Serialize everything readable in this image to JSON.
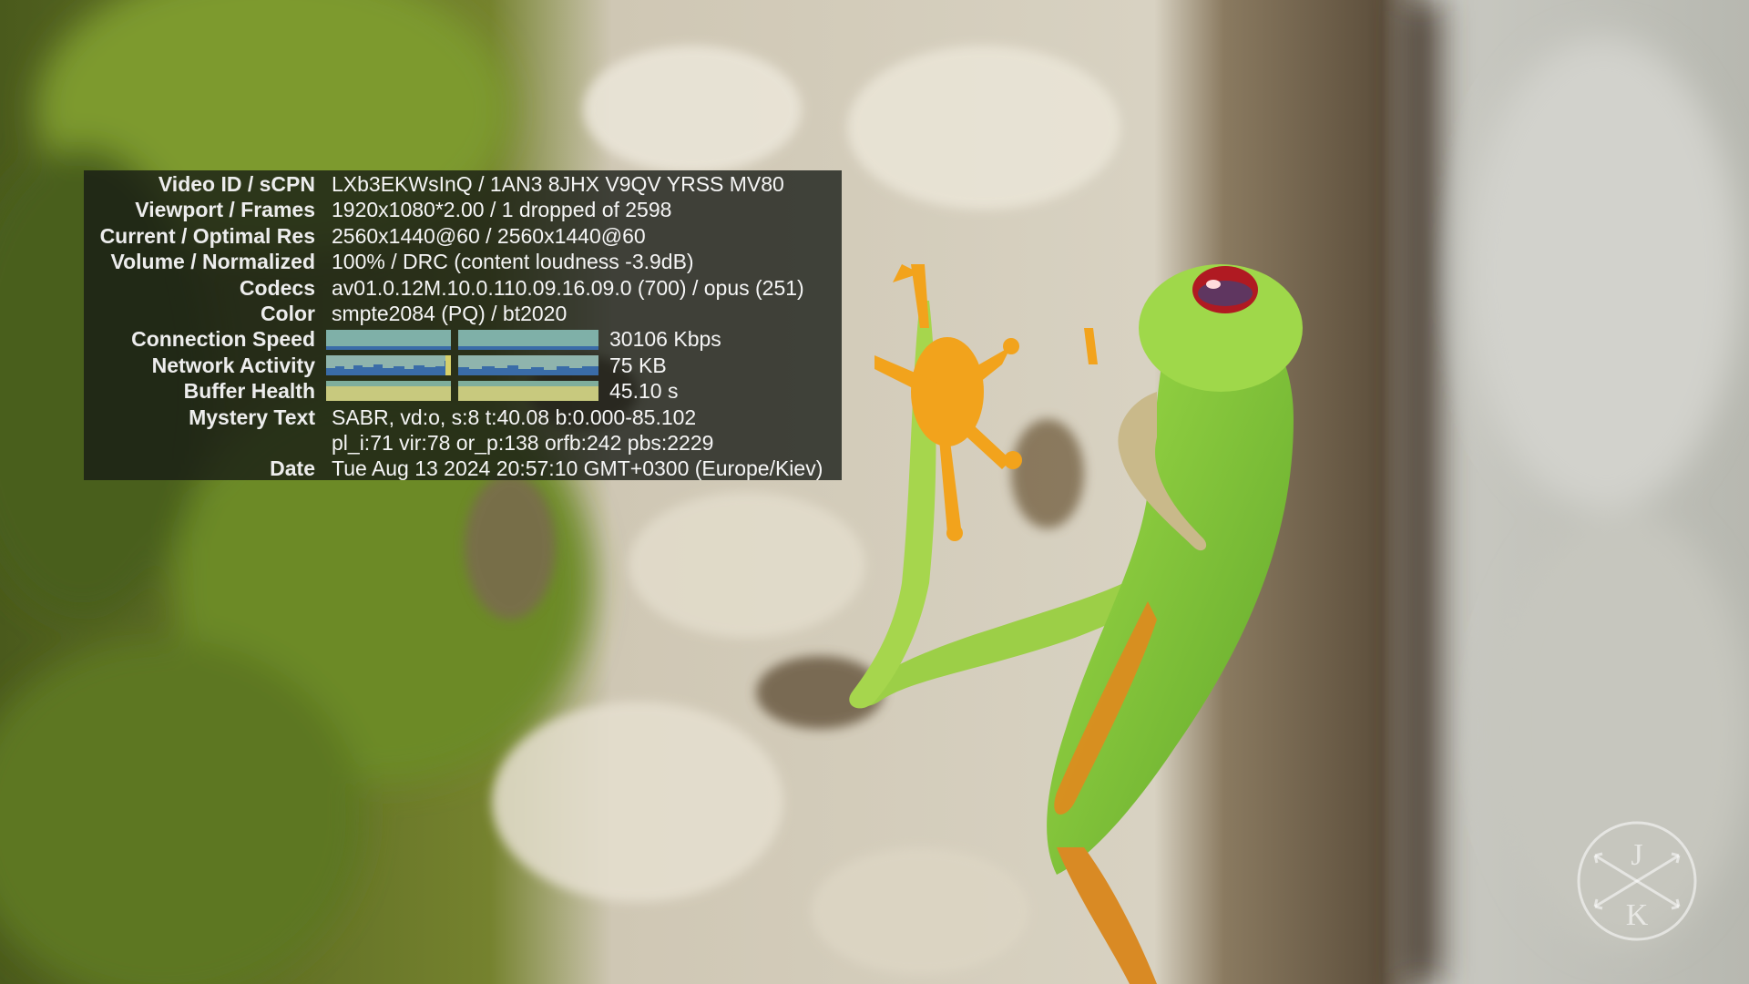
{
  "stats": {
    "rows": [
      {
        "label": "Video ID / sCPN",
        "value": "LXb3EKWsInQ / 1AN3 8JHX V9QV YRSS MV80"
      },
      {
        "label": "Viewport / Frames",
        "value": "1920x1080*2.00 / 1 dropped of 2598"
      },
      {
        "label": "Current / Optimal Res",
        "value": "2560x1440@60 / 2560x1440@60"
      },
      {
        "label": "Volume / Normalized",
        "value": "100% / DRC (content loudness -3.9dB)"
      },
      {
        "label": "Codecs",
        "value": "av01.0.12M.10.0.110.09.16.09.0 (700) / opus (251)"
      },
      {
        "label": "Color",
        "value": "smpte2084 (PQ) / bt2020"
      }
    ],
    "connection_speed": {
      "label": "Connection Speed",
      "value": "30106 Kbps"
    },
    "network_activity": {
      "label": "Network Activity",
      "value": "75 KB"
    },
    "buffer_health": {
      "label": "Buffer Health",
      "value": "45.10 s"
    },
    "mystery_text": {
      "label": "Mystery Text",
      "line1": "SABR, vd:o, s:8 t:40.08 b:0.000-85.102",
      "line2": "pl_i:71 vir:78 or_p:138 orfb:242 pbs:2229"
    },
    "date": {
      "label": "Date",
      "value": "Tue Aug 13 2024 20:57:10 GMT+0300 (Europe/Kiev)"
    }
  },
  "watermark": {
    "letter_top": "J",
    "letter_bottom": "K"
  },
  "colors": {
    "panel_bg": "#161a14",
    "frog_green": "#8fd43a",
    "frog_eye": "#b01a22",
    "moss": "#6b8a2a",
    "bark": "#d9d4c6"
  }
}
